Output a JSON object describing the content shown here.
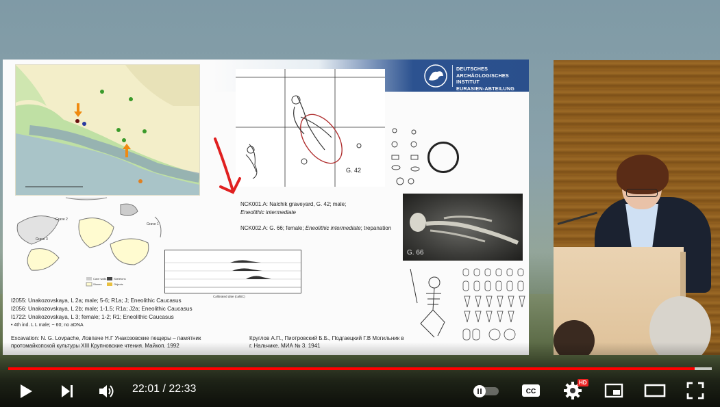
{
  "slide": {
    "institute_line1": "DEUTSCHES",
    "institute_line2": "ARCHÄOLOGISCHES INSTITUT",
    "institute_line3": "EURASIEN-ABTEILUNG",
    "caption1": "NCK001.A: Nalchik graveyard, G. 42; male;",
    "caption1_sub": "Eneolithic intermediate",
    "caption2_prefix": "NCK002.A: G. 66; female;",
    "caption2_italic": "Eneolithic intermediate",
    "caption2_suffix": "; trepanation",
    "grid_label": "G. 42",
    "photo_label": "G. 66",
    "note1": "I2055: Unakozovskaya, L 2a; male; 5-6; R1a; J; Eneolithic Caucasus",
    "note2": "I2056: Unakozovskaya, L 2b; male; 1-1.5; R1a; J2a; Eneolithic Caucasus",
    "note3": "I1722: Unakozovskaya, L 3; female; 1-2; R1; Eneolithic Caucasus",
    "note4": "• 4th ind. L L male; ~ 60; no aDNA",
    "excavation": "Excavation: N. G. Lovpache, Ловпаче Н.Г Унакозовские пещеры – памятник протомайкопской культуры XIII Крупновские чтения. Майкоп. 1992",
    "reference2": "Круглов А.П., Пиотровский Б.Б., Подгаецкий Г.В Могильник в г. Нальчике. МИА № 3. 1941",
    "radiocarbon_axis": "Calibrated date (calBC)"
  },
  "player": {
    "current_time": "22:01",
    "separator": " / ",
    "duration": "22:33",
    "progress_fraction": 0.976,
    "hd_badge": "HD",
    "accent_color": "#ff0000"
  }
}
